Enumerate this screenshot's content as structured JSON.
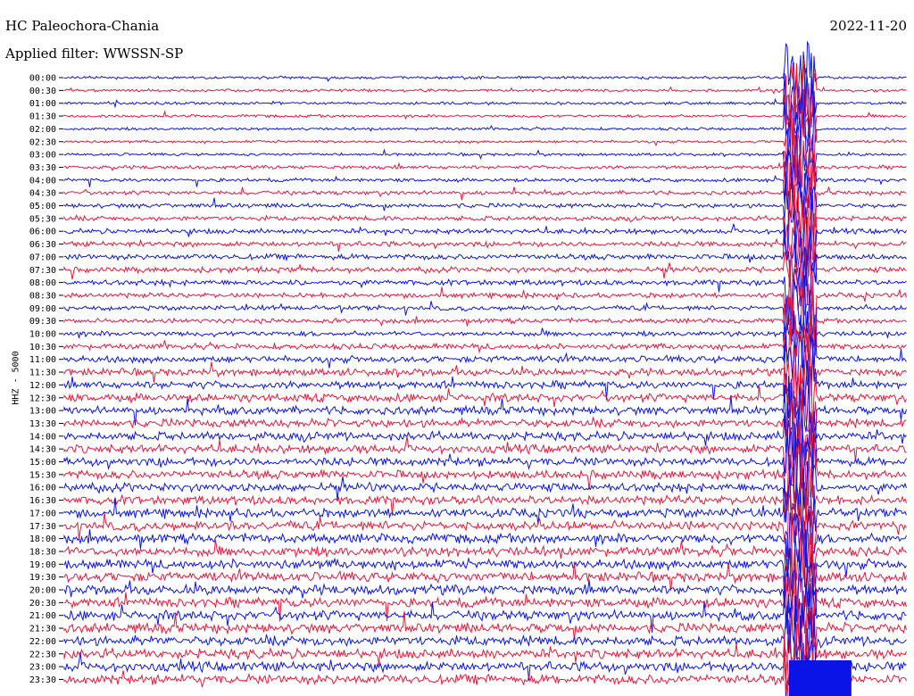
{
  "header": {
    "station": "HC Paleochora-Chania",
    "filter": "Applied filter: WWSSN-SP",
    "date": "2022-11-20"
  },
  "chart_data": {
    "type": "line",
    "title": "HC Paleochora-Chania",
    "ylabel": "HHZ - 5000",
    "colors": {
      "even": "#0a14e6",
      "odd": "#e8173c"
    },
    "row_labels": [
      "00:00",
      "00:30",
      "01:00",
      "01:30",
      "02:00",
      "02:30",
      "03:00",
      "03:30",
      "04:00",
      "04:30",
      "05:00",
      "05:30",
      "06:00",
      "06:30",
      "07:00",
      "07:30",
      "08:00",
      "08:30",
      "09:00",
      "09:30",
      "10:00",
      "10:30",
      "11:00",
      "11:30",
      "12:00",
      "12:30",
      "13:00",
      "13:30",
      "14:00",
      "14:30",
      "15:00",
      "15:30",
      "16:00",
      "16:30",
      "17:00",
      "17:30",
      "18:00",
      "18:30",
      "19:00",
      "19:30",
      "20:00",
      "20:30",
      "21:00",
      "21:30",
      "22:00",
      "22:30",
      "23:00",
      "23:30"
    ],
    "noise_level": [
      1,
      1,
      1,
      1,
      1,
      1,
      1,
      1.3,
      1.3,
      1.5,
      1.6,
      1.7,
      1.8,
      1.9,
      2,
      2,
      2,
      1.8,
      1.7,
      1.7,
      1.8,
      2.1,
      2.4,
      2.6,
      2.8,
      3,
      3,
      3,
      3.1,
      3.1,
      3.1,
      3.1,
      3.1,
      3.2,
      3.2,
      3.3,
      3.4,
      3.5,
      3.5,
      3.5,
      3.5,
      3.5,
      3.5,
      3.5,
      3.5,
      3.5,
      3.5,
      3.5
    ],
    "event_start_row": 0,
    "event_column_fraction": 0.86
  }
}
